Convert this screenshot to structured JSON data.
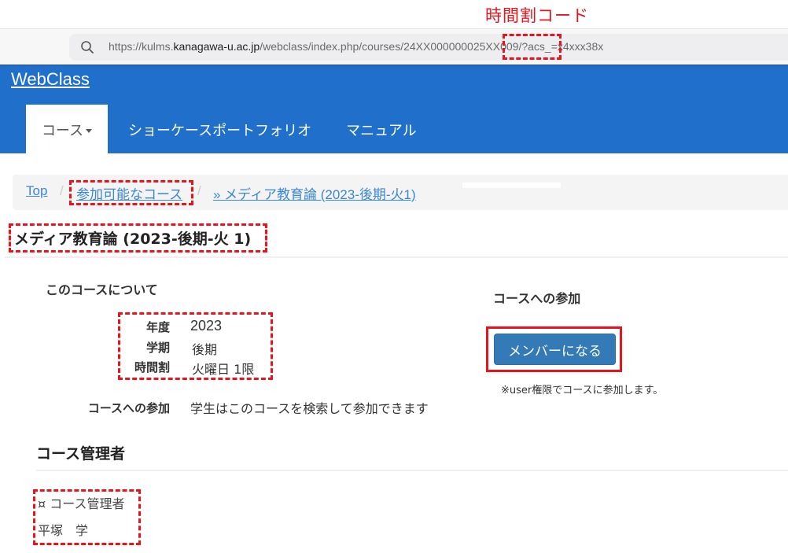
{
  "annotation": {
    "label": "時間割コード",
    "color": "#e8141c"
  },
  "browser": {
    "url_prefix": "https://kulms.",
    "url_host": "kanagawa-u.ac.jp",
    "url_path": "/webclass/index.php/courses/24XX000000025XX009/?acs_=x4xxx38x",
    "search_icon": "search-icon"
  },
  "navbar": {
    "brand": "WebClass",
    "color": "#1f6fcb",
    "items": [
      {
        "label": "コース",
        "active": true,
        "has_dropdown": true
      },
      {
        "label": "ショーケースポートフォリオ",
        "active": false
      },
      {
        "label": "マニュアル",
        "active": false
      }
    ]
  },
  "breadcrumb": {
    "items": [
      {
        "label": "Top"
      },
      {
        "label": "参加可能なコース"
      },
      {
        "label": "» メディア教育論 (2023-後期-火1)"
      }
    ],
    "separator": "/"
  },
  "page": {
    "title": "メディア教育論 (2023-後期-火 1)"
  },
  "about": {
    "heading": "このコースについて",
    "fields": [
      {
        "term": "年度",
        "value": "2023"
      },
      {
        "term": "学期",
        "value": "後期"
      },
      {
        "term": "時間割",
        "value": "火曜日 1限"
      }
    ],
    "join_term": "コースへの参加",
    "join_value": "学生はこのコースを検索して参加できます"
  },
  "join": {
    "heading": "コースへの参加",
    "button_label": "メンバーになる",
    "button_color": "#337ab7",
    "note": "※user権限でコースに参加します。"
  },
  "admins": {
    "heading": "コース管理者",
    "label": "¤ コース管理者",
    "names": [
      "平塚　学"
    ]
  }
}
